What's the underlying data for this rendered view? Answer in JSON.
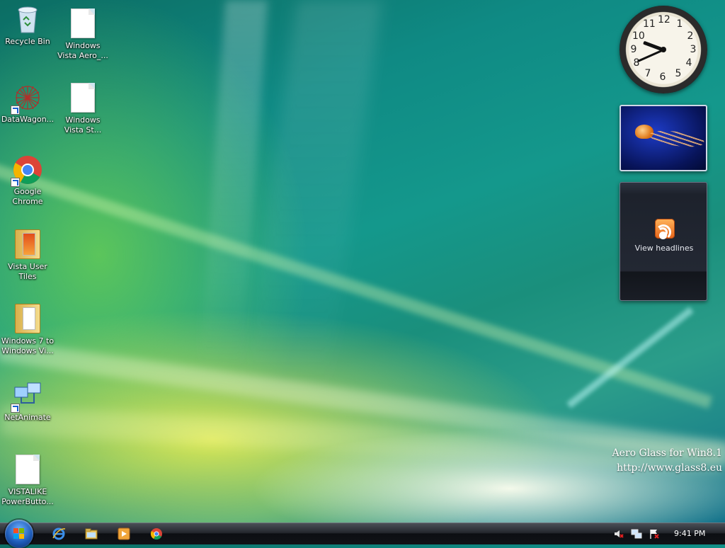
{
  "desktop": {
    "icons": [
      {
        "label": "Recycle Bin",
        "icon": "recycle-bin-icon"
      },
      {
        "label": "Windows Vista Aero_...",
        "icon": "document-icon"
      },
      {
        "label": "DataWagon...",
        "icon": "datawagon-icon"
      },
      {
        "label": "Windows Vista St...",
        "icon": "document-icon"
      },
      {
        "label": "Google Chrome",
        "icon": "chrome-icon"
      },
      {
        "label": "Vista User Tiles",
        "icon": "folder-icon"
      },
      {
        "label": "Windows 7 to Windows Vi...",
        "icon": "folder-icon"
      },
      {
        "label": "NetAnimate",
        "icon": "network-icon"
      },
      {
        "label": "VISTALIKE PowerButto...",
        "icon": "document-icon"
      }
    ]
  },
  "gadgets": {
    "clock": {
      "numbers": [
        "12",
        "1",
        "2",
        "3",
        "4",
        "5",
        "6",
        "7",
        "8",
        "9",
        "10",
        "11"
      ],
      "time": "9:41"
    },
    "slideshow": {
      "image": "jellyfish"
    },
    "feed": {
      "label": "View headlines",
      "icon": "rss-icon"
    }
  },
  "watermark": {
    "line1": "Aero Glass for Win8.1",
    "line2": "http://www.glass8.eu"
  },
  "taskbar": {
    "start_icon": "windows-start-orb-icon",
    "quick_launch": [
      "internet-explorer-icon",
      "file-explorer-icon",
      "media-player-icon",
      "chrome-icon"
    ],
    "tray": [
      "volume-muted-icon",
      "network-icon",
      "action-center-flag-icon"
    ],
    "clock": "9:41 PM"
  }
}
